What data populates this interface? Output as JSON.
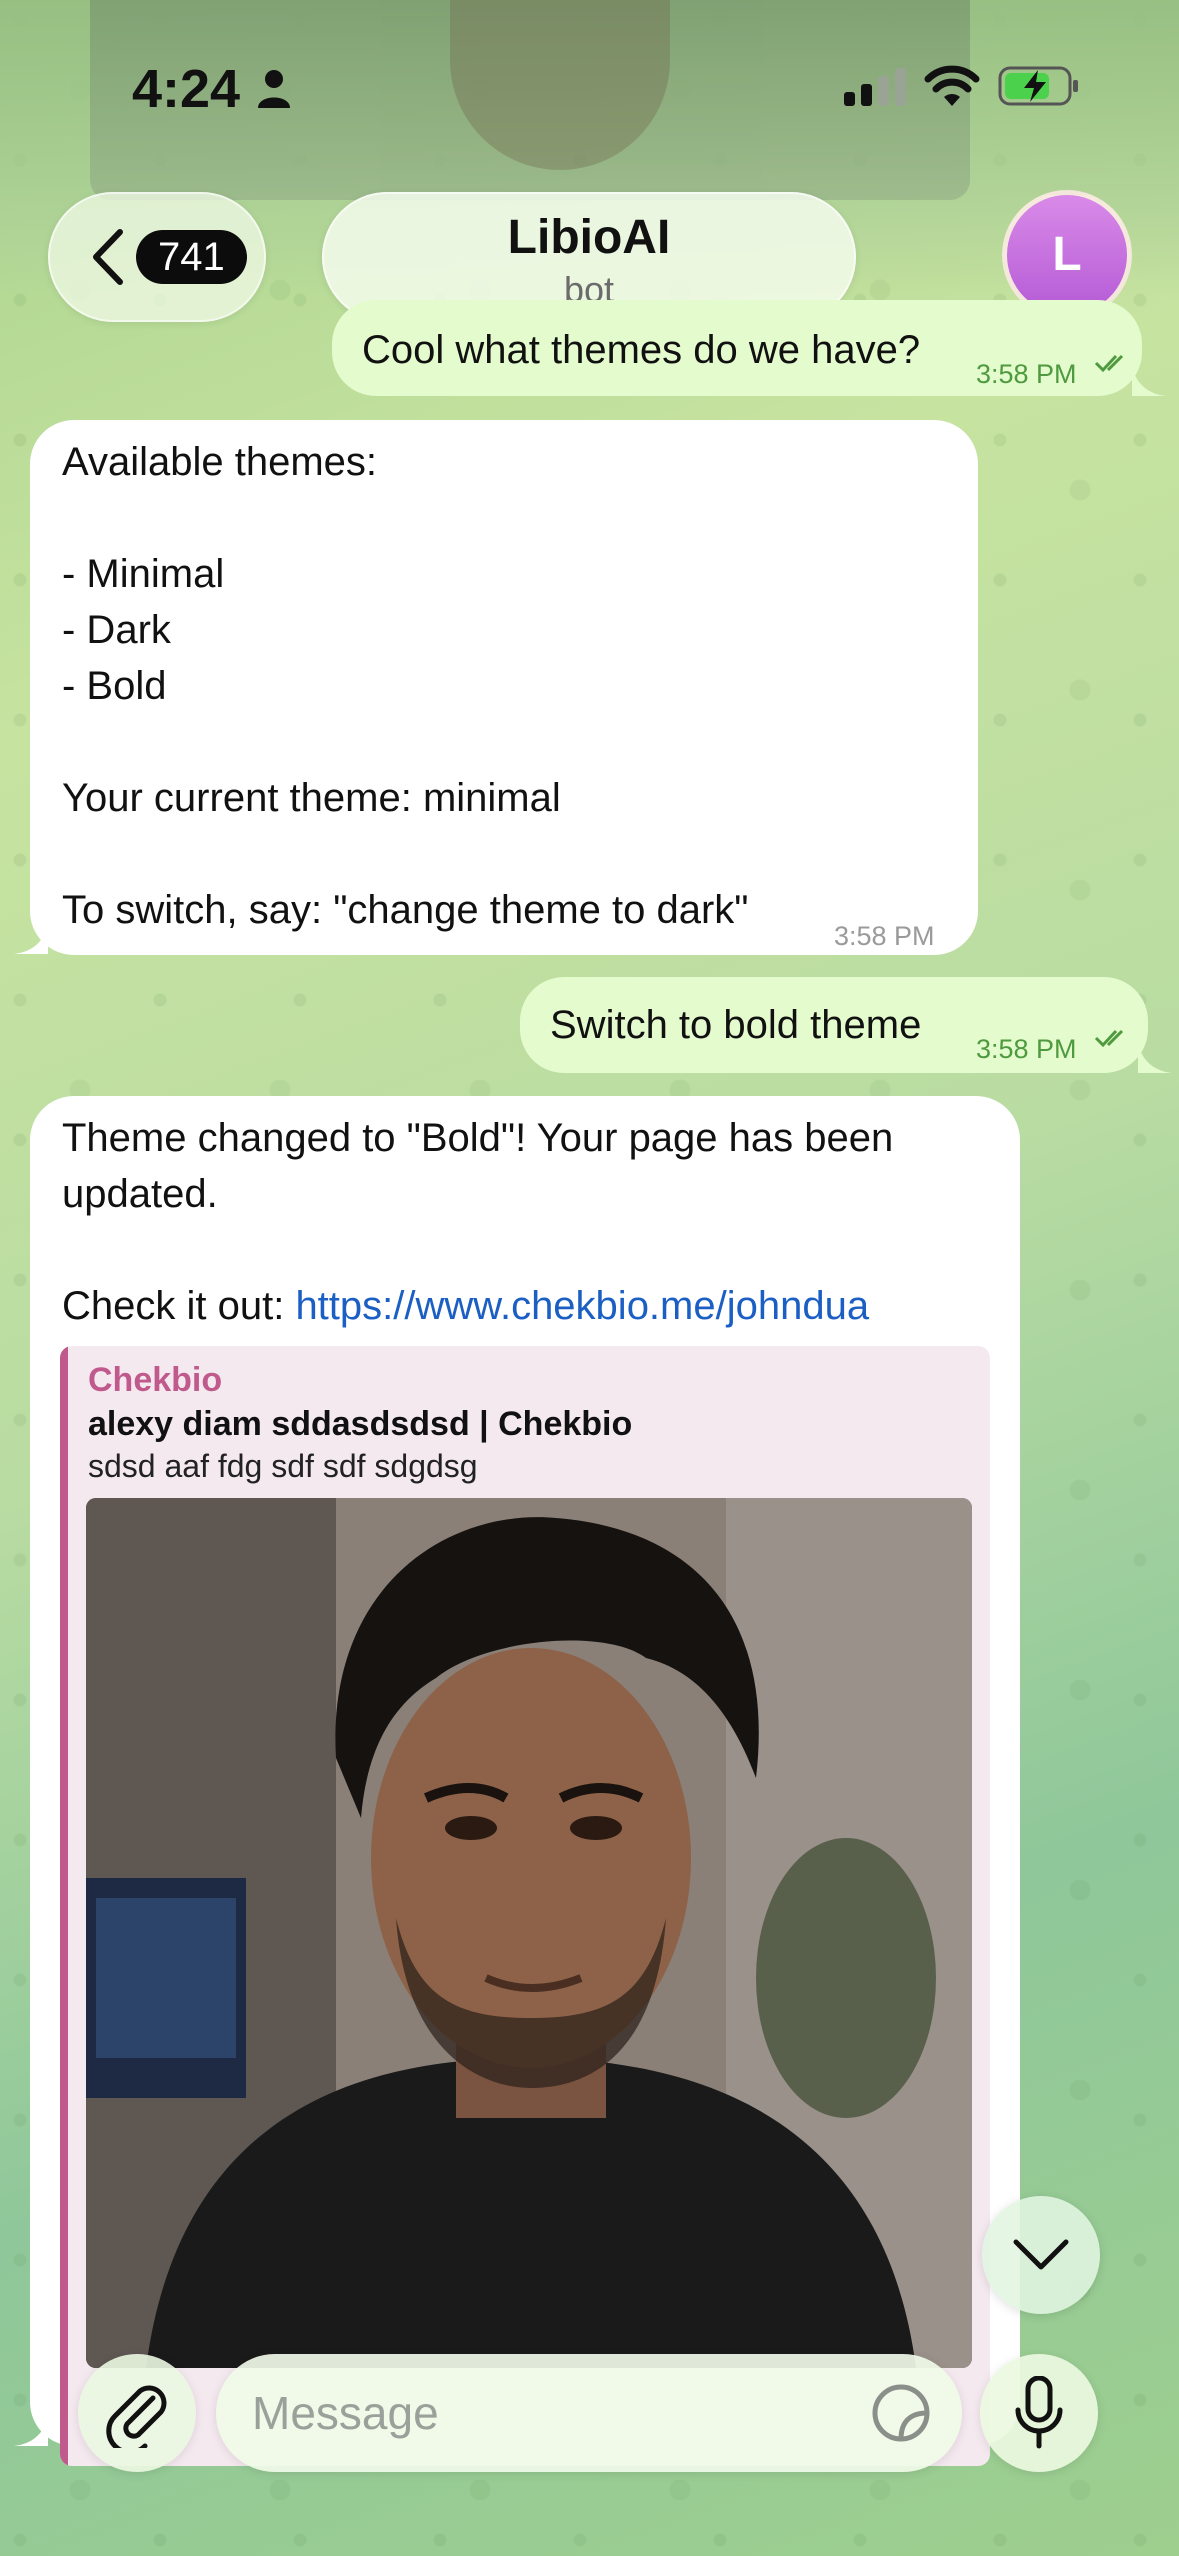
{
  "status_bar": {
    "time": "4:24",
    "icons": [
      "person-icon",
      "cellular-signal-icon",
      "wifi-icon",
      "battery-charging-icon"
    ]
  },
  "header": {
    "back_count": "741",
    "title": "LibioAI",
    "subtitle": "bot",
    "avatar_initial": "L",
    "avatar_color": "#c46fe0"
  },
  "messages": [
    {
      "direction": "out",
      "text": "Cool what themes do we have?",
      "time": "3:58 PM",
      "read": true
    },
    {
      "direction": "in",
      "text": "Available themes:\n\n- Minimal\n- Dark\n- Bold\n\nYour current theme: minimal\n\nTo switch, say: \"change theme to dark\"",
      "time": "3:58 PM"
    },
    {
      "direction": "out",
      "text": "Switch to bold theme",
      "time": "3:58 PM",
      "read": true
    },
    {
      "direction": "in",
      "text": "Theme changed to \"Bold\"! Your page has been updated.\n\nCheck it out: ",
      "link": "https://www.chekbio.me/johndua",
      "preview": {
        "site": "Chekbio",
        "title": "alexy diam sddasdsdsd | Chekbio",
        "description": "sdsd aaf fdg sdf sdf sdgdsg",
        "accent_color": "#c05a8c"
      }
    }
  ],
  "composer": {
    "placeholder": "Message"
  },
  "colors": {
    "outgoing_bubble": "#e4fbce",
    "incoming_bubble": "#ffffff",
    "link": "#1c5fc4"
  }
}
